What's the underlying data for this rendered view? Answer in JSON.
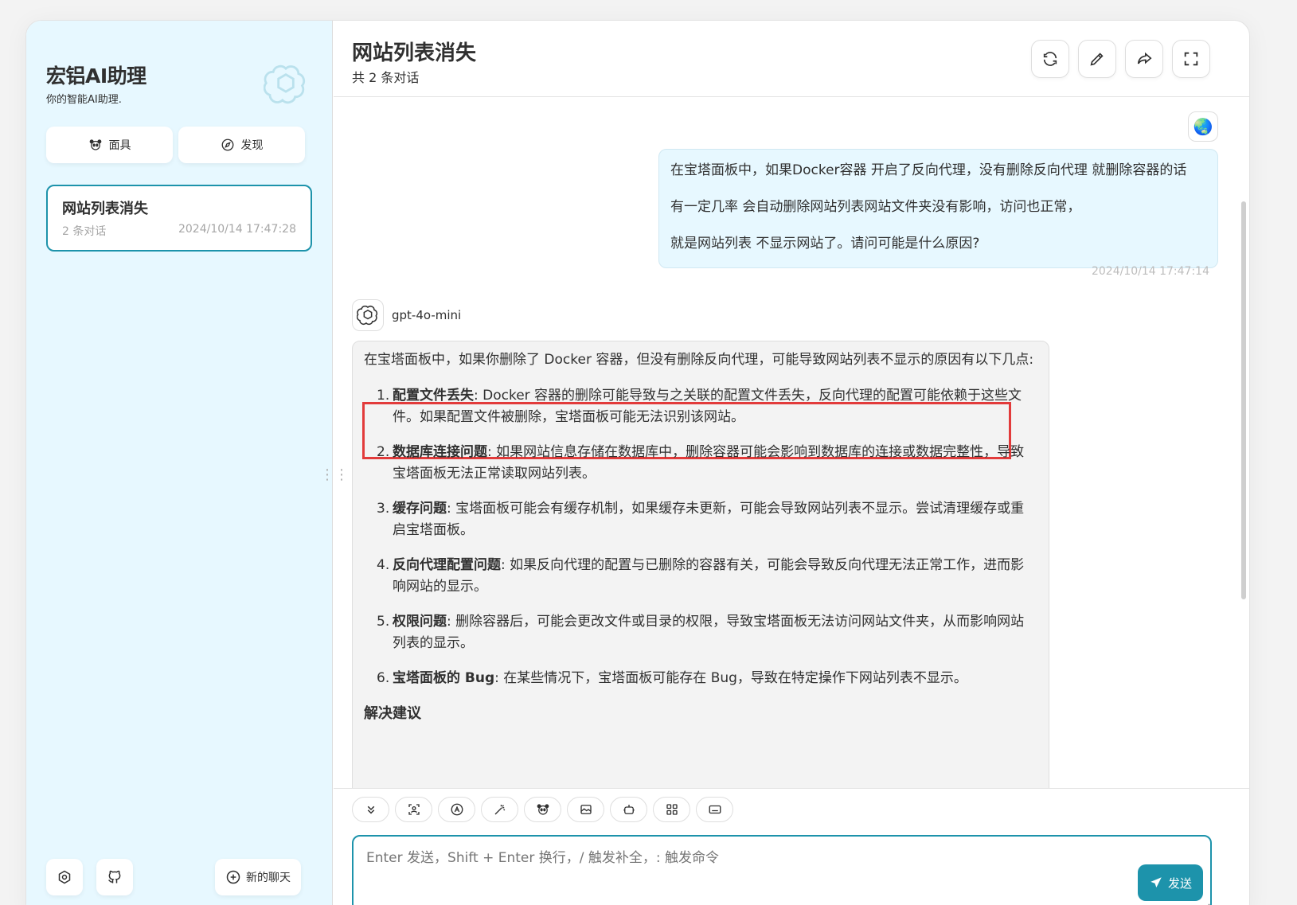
{
  "sidebar": {
    "title": "宏铝AI助理",
    "subtitle": "你的智能AI助理.",
    "mask_label": "面具",
    "discover_label": "发现",
    "chats": [
      {
        "title": "网站列表消失",
        "count": "2 条对话",
        "time": "2024/10/14 17:47:28"
      }
    ],
    "new_chat_label": "新的聊天"
  },
  "header": {
    "title": "网站列表消失",
    "subtitle": "共 2 条对话"
  },
  "messages": {
    "user": {
      "avatar": "🌏",
      "lines": [
        "在宝塔面板中，如果Docker容器 开启了反向代理，没有删除反向代理 就删除容器的话",
        "有一定几率 会自动删除网站列表网站文件夹没有影响，访问也正常，",
        "就是网站列表 不显示网站了。请问可能是什么原因?"
      ],
      "time": "2024/10/14 17:47:14"
    },
    "bot": {
      "model": "gpt-4o-mini",
      "intro": "在宝塔面板中，如果你删除了 Docker 容器，但没有删除反向代理，可能导致网站列表不显示的原因有以下几点:",
      "items": [
        {
          "num": "1.",
          "title": "配置文件丢失",
          "text": ": Docker 容器的删除可能导致与之关联的配置文件丢失，反向代理的配置可能依赖于这些文件。如果配置文件被删除，宝塔面板可能无法识别该网站。"
        },
        {
          "num": "2.",
          "title": "数据库连接问题",
          "text": ": 如果网站信息存储在数据库中，删除容器可能会影响到数据库的连接或数据完整性，导致宝塔面板无法正常读取网站列表。"
        },
        {
          "num": "3.",
          "title": "缓存问题",
          "text": ": 宝塔面板可能会有缓存机制，如果缓存未更新，可能会导致网站列表不显示。尝试清理缓存或重启宝塔面板。"
        },
        {
          "num": "4.",
          "title": "反向代理配置问题",
          "text": ": 如果反向代理的配置与已删除的容器有关，可能会导致反向代理无法正常工作，进而影响网站的显示。"
        },
        {
          "num": "5.",
          "title": "权限问题",
          "text": ": 删除容器后，可能会更改文件或目录的权限，导致宝塔面板无法访问网站文件夹，从而影响网站列表的显示。"
        },
        {
          "num": "6.",
          "title": "宝塔面板的 Bug",
          "text": ": 在某些情况下，宝塔面板可能存在 Bug，导致在特定操作下网站列表不显示。"
        }
      ],
      "section": "解决建议"
    }
  },
  "composer": {
    "placeholder": "Enter 发送，Shift + Enter 换行，/ 触发补全，: 触发命令",
    "send_label": "发送"
  },
  "colors": {
    "accent": "#1d93ab",
    "sidebar_bg": "#e7f8ff",
    "highlight": "#e23b3b"
  }
}
